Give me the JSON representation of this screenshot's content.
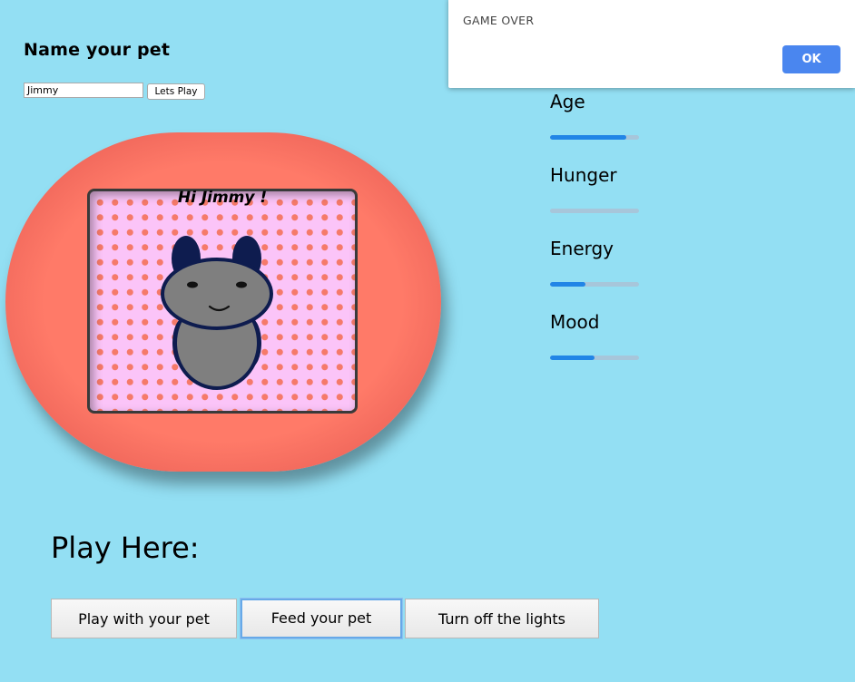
{
  "name_section": {
    "title": "Name your pet",
    "input_value": "Jimmy",
    "start_button": "Lets Play"
  },
  "screen": {
    "greeting": "Hi Jimmy !"
  },
  "stats": [
    {
      "label": "Age",
      "level": 0.86
    },
    {
      "label": "Hunger",
      "level": 0.0
    },
    {
      "label": "Energy",
      "level": 0.4
    },
    {
      "label": "Mood",
      "level": 0.5
    }
  ],
  "play_here": "Play Here:",
  "actions": {
    "play": "Play with your pet",
    "feed": "Feed your pet",
    "lights": "Turn off the lights"
  },
  "dialog": {
    "message": "GAME OVER",
    "ok": "OK"
  },
  "colors": {
    "background": "#93dff3",
    "device": "#ff7a68",
    "screen": "#fbc4f8",
    "dots": "#f57a6a",
    "pet_body": "#0e1c4f",
    "pet_face": "#7f7f7f",
    "bar_fill": "#2185e6",
    "ok_button": "#4a86ef"
  }
}
